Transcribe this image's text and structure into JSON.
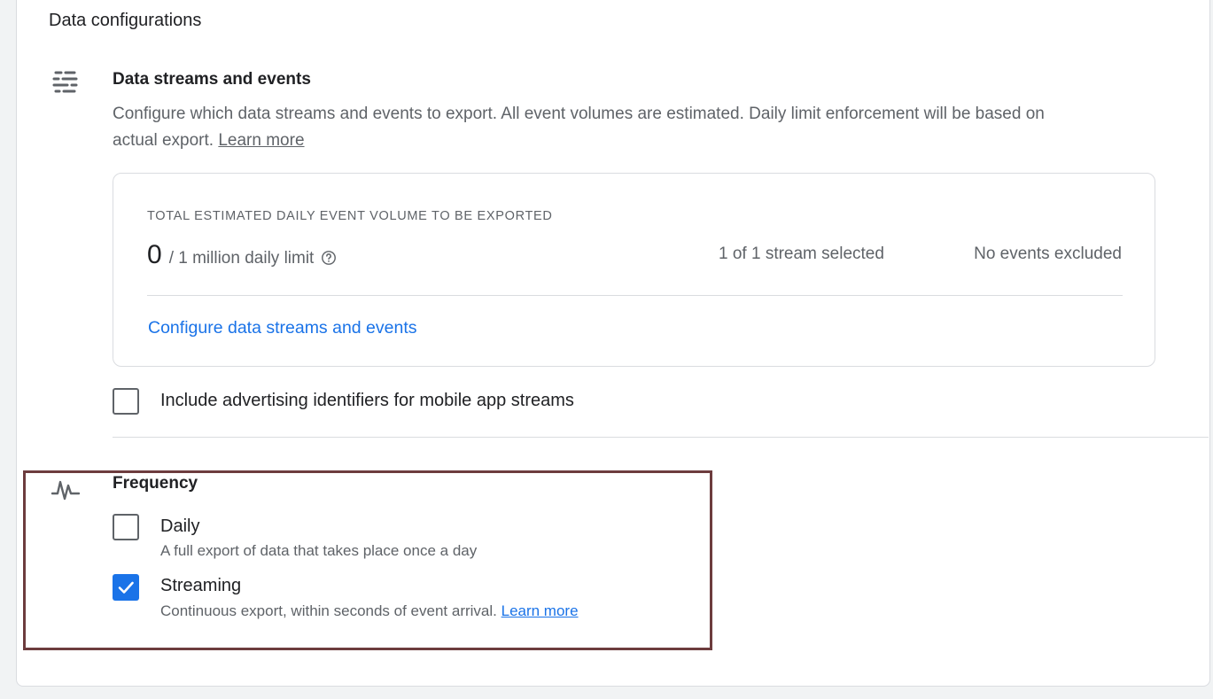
{
  "section": {
    "title": "Data configurations"
  },
  "streams": {
    "icon": "streams-lines-icon",
    "title": "Data streams and events",
    "description": "Configure which data streams and events to export. All event volumes are estimated. Daily limit enforcement will be based on actual export.",
    "learn_more": "Learn more"
  },
  "volume": {
    "heading": "TOTAL ESTIMATED DAILY EVENT VOLUME TO BE EXPORTED",
    "value": "0",
    "limit": "/ 1 million daily limit",
    "help_icon": "help-circle-icon",
    "streams_selected": "1 of 1 stream selected",
    "events_excluded": "No events excluded",
    "configure_link": "Configure data streams and events"
  },
  "advertising": {
    "label": "Include advertising identifiers for mobile app streams",
    "checked": false
  },
  "frequency": {
    "icon": "pulse-icon",
    "title": "Frequency",
    "daily": {
      "label": "Daily",
      "description": "A full export of data that takes place once a day",
      "checked": false
    },
    "streaming": {
      "label": "Streaming",
      "description": "Continuous export, within seconds of event arrival.",
      "learn_more": "Learn more",
      "checked": true
    }
  },
  "colors": {
    "accent": "#1a73e8",
    "highlight_border": "#6d3c3e",
    "text_secondary": "#5f6368"
  }
}
